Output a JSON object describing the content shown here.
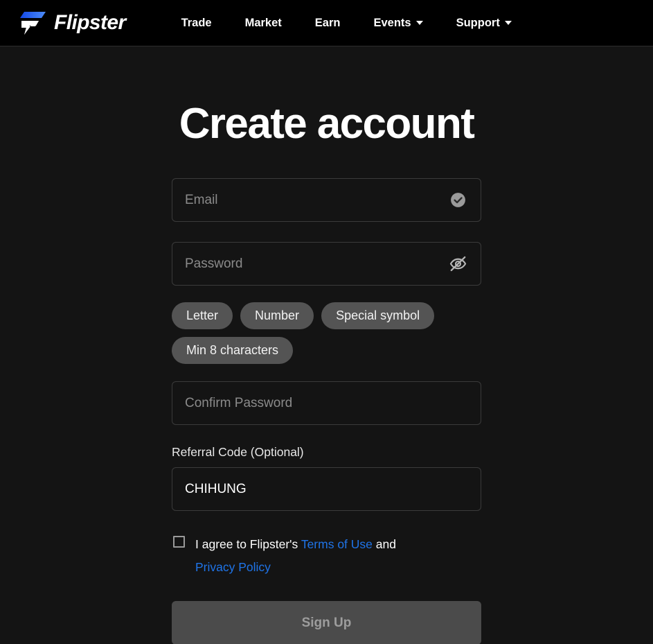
{
  "header": {
    "brand_name": "Flipster",
    "logo_icon": "flipster-logo-icon",
    "nav": [
      {
        "label": "Trade",
        "has_caret": false
      },
      {
        "label": "Market",
        "has_caret": false
      },
      {
        "label": "Earn",
        "has_caret": false
      },
      {
        "label": "Events",
        "has_caret": true
      },
      {
        "label": "Support",
        "has_caret": true
      }
    ]
  },
  "main": {
    "title": "Create account",
    "email": {
      "placeholder": "Email",
      "value": "",
      "icon": "check-circle-icon"
    },
    "password": {
      "placeholder": "Password",
      "value": "",
      "icon": "eye-off-icon"
    },
    "password_rules": [
      "Letter",
      "Number",
      "Special symbol",
      "Min 8 characters"
    ],
    "confirm_password": {
      "placeholder": "Confirm Password",
      "value": ""
    },
    "referral": {
      "label": "Referral Code (Optional)",
      "placeholder": "Referral Code",
      "value": "CHIHUNG"
    },
    "terms": {
      "checked": false,
      "prefix": "I agree to Flipster's",
      "terms_link": "Terms of Use",
      "conjunction": "and",
      "privacy_link": "Privacy Policy"
    },
    "submit_label": "Sign Up"
  },
  "colors": {
    "header_bg": "#000000",
    "page_bg": "#141414",
    "accent_link": "#1f74e8",
    "logo_blue": "#1a5cf0",
    "pill_bg": "#545454",
    "submit_bg": "#4b4b4b",
    "submit_text": "#9d9d9d",
    "placeholder": "#8b8b8b"
  }
}
